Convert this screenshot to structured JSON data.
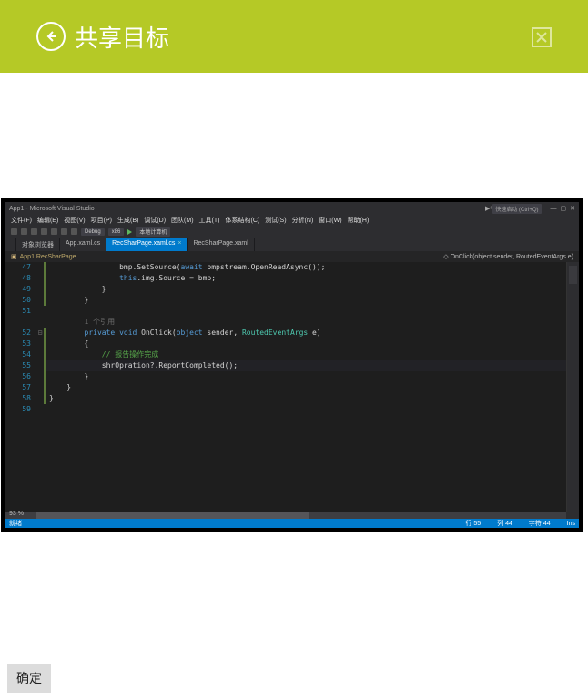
{
  "header": {
    "title": "共享目标"
  },
  "ok_button": "确定",
  "vs": {
    "titlebar": "App1 - Microsoft Visual Studio",
    "search_placeholder": "快速启动 (Ctrl+Q)",
    "menu": [
      "文件(F)",
      "编辑(E)",
      "视图(V)",
      "项目(P)",
      "生成(B)",
      "调试(D)",
      "团队(M)",
      "工具(T)",
      "体系结构(C)",
      "测试(S)",
      "分析(N)",
      "窗口(W)",
      "帮助(H)"
    ],
    "toolbar": {
      "config": "Debug",
      "platform": "x86",
      "run": "本地计算机"
    },
    "tabs": [
      {
        "label": "对象浏览器",
        "active": false
      },
      {
        "label": "App.xaml.cs",
        "active": false
      },
      {
        "label": "RecSharPage.xaml.cs",
        "active": true
      },
      {
        "label": "RecSharPage.xaml",
        "active": false
      }
    ],
    "navbar_left": "App1.RecSharPage",
    "navbar_right": "OnClick(object sender, RoutedEventArgs e)",
    "hscroll_pct": "93 %",
    "status": {
      "left": "就绪",
      "line": "行 55",
      "col": "列 44",
      "ch": "字符 44",
      "ins": "Ins"
    },
    "line_start": 47,
    "line_end": 59,
    "fold_lines": [
      52
    ],
    "ref_label": "1 个引用",
    "code": [
      {
        "frags": [
          {
            "t": "                bmp.SetSource("
          },
          {
            "t": "await",
            "c": "kw2"
          },
          {
            "t": " bmpstream.OpenReadAsync());"
          }
        ]
      },
      {
        "frags": [
          {
            "t": "                "
          },
          {
            "t": "this",
            "c": "kw"
          },
          {
            "t": ".img.Source = bmp;"
          }
        ]
      },
      {
        "frags": [
          {
            "t": "            }"
          }
        ]
      },
      {
        "frags": [
          {
            "t": "        }"
          }
        ]
      },
      {
        "frags": [
          {
            "t": ""
          }
        ]
      },
      {
        "ref": true
      },
      {
        "frags": [
          {
            "t": "        "
          },
          {
            "t": "private",
            "c": "kw"
          },
          {
            "t": " "
          },
          {
            "t": "void",
            "c": "kw"
          },
          {
            "t": " OnClick("
          },
          {
            "t": "object",
            "c": "kw"
          },
          {
            "t": " sender, "
          },
          {
            "t": "RoutedEventArgs",
            "c": "type"
          },
          {
            "t": " e)"
          }
        ]
      },
      {
        "frags": [
          {
            "t": "        {"
          }
        ]
      },
      {
        "frags": [
          {
            "t": "            "
          },
          {
            "t": "// 报告操作完成",
            "c": "cmt"
          }
        ]
      },
      {
        "hl": true,
        "frags": [
          {
            "t": "            shrOpration?.ReportCompleted();"
          }
        ]
      },
      {
        "frags": [
          {
            "t": "        }"
          }
        ]
      },
      {
        "frags": [
          {
            "t": "    }"
          }
        ]
      },
      {
        "frags": [
          {
            "t": "}"
          }
        ]
      },
      {
        "frags": [
          {
            "t": ""
          }
        ]
      }
    ]
  }
}
